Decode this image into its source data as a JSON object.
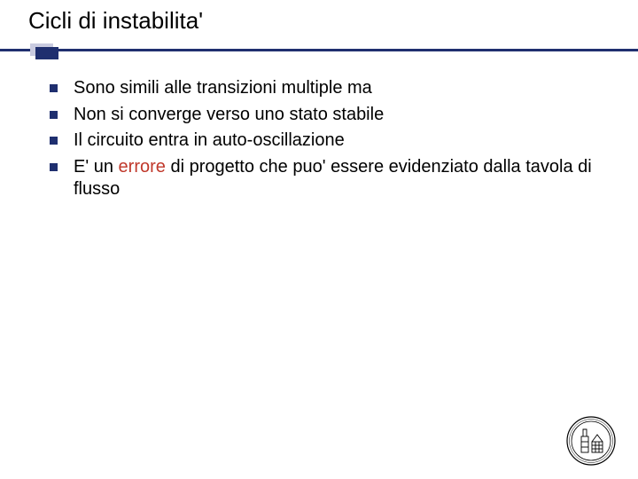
{
  "title": "Cicli di instabilita'",
  "bullets": [
    {
      "pre": "Sono simili alle transizioni multiple ma",
      "err": "",
      "post": ""
    },
    {
      "pre": "Non si converge verso uno stato stabile",
      "err": "",
      "post": ""
    },
    {
      "pre": "Il circuito entra in auto-oscillazione",
      "err": "",
      "post": ""
    },
    {
      "pre": "E' un ",
      "err": "errore",
      "post": " di progetto che puo' essere evidenziato dalla tavola di flusso"
    }
  ]
}
